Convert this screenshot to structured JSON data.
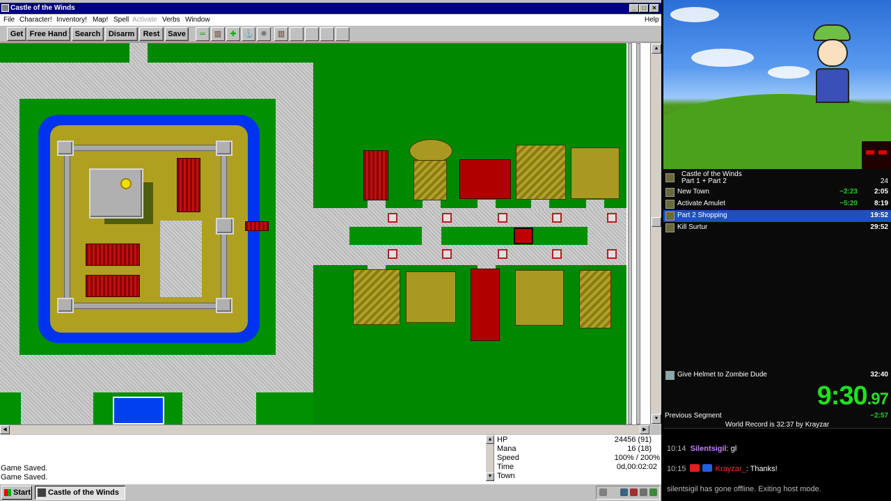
{
  "window": {
    "title": "Castle of the Winds",
    "min_glyph": "_",
    "max_glyph": "□",
    "close_glyph": "✕"
  },
  "menu": {
    "items": [
      "File",
      "Character!",
      "Inventory!",
      "Map!",
      "Spell",
      "Activate",
      "Verbs",
      "Window"
    ],
    "help": "Help"
  },
  "toolbar": {
    "buttons": [
      "Get",
      "Free Hand",
      "Search",
      "Disarm",
      "Rest",
      "Save"
    ]
  },
  "messages": [
    "Game Saved.",
    "Game Saved."
  ],
  "stats": {
    "hp_label": "HP",
    "hp_value": "24456 (91)",
    "mana_label": "Mana",
    "mana_value": "16 (18)",
    "speed_label": "Speed",
    "speed_value": "100% / 200%",
    "time_label": "Time",
    "time_value": "0d,00:02:02",
    "location": "Town"
  },
  "taskbar": {
    "start": "Start",
    "task": "Castle of the Winds"
  },
  "splits": {
    "game": "Castle of the Winds",
    "category": "Part 1 + Part 2",
    "attempts": "24",
    "rows": [
      {
        "name": "New Town",
        "delta": "−2:23",
        "time": "2:05"
      },
      {
        "name": "Activate Amulet",
        "delta": "−5:20",
        "time": "8:19"
      },
      {
        "name": "Part 2 Shopping",
        "delta": "",
        "time": "19:52"
      },
      {
        "name": "Kill Surtur",
        "delta": "",
        "time": "29:52"
      }
    ],
    "final": {
      "name": "Give Helmet to Zombie Dude",
      "time": "32:40"
    },
    "timer_main": "9:30",
    "timer_frac": ".97",
    "previous_label": "Previous Segment",
    "previous_value": "−2:57",
    "world_record": "World Record is 32:37 by Krayzar"
  },
  "chat": {
    "lines": [
      {
        "time": "10:14",
        "user": "Silentsigil",
        "text": ": gl"
      },
      {
        "time": "10:15",
        "user": "Krayzar_",
        "text": ": Thanks!"
      }
    ],
    "system": "silentsigil has gone offline. Exiting host mode."
  },
  "colors": {
    "title_bar": "#000080",
    "grass": "#008800",
    "moat": "#0033ee",
    "split_active": "#2050c0",
    "timer": "#1fe01f"
  }
}
